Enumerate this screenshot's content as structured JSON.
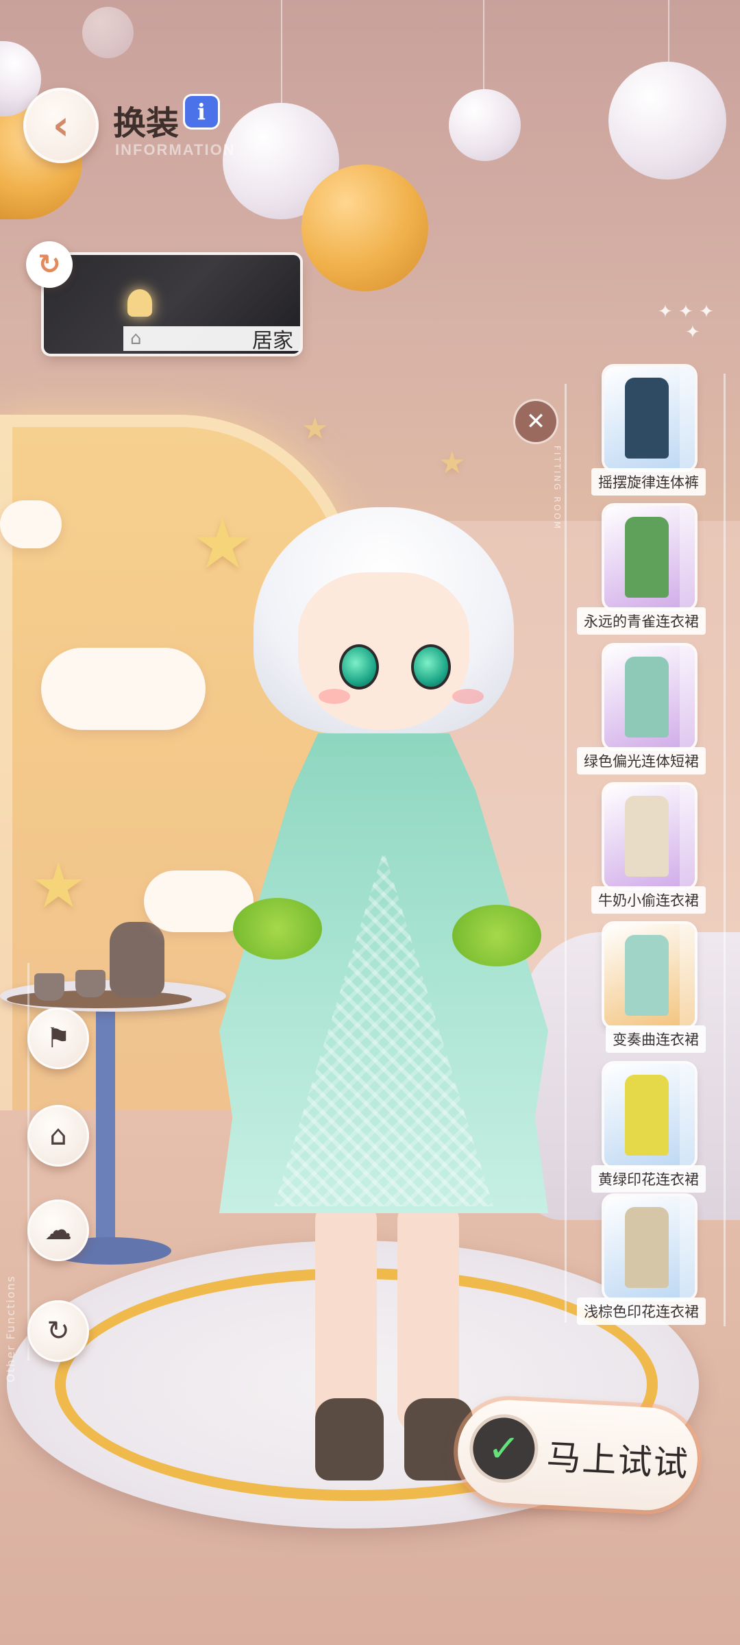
{
  "header": {
    "back_icon": "back-arrow-icon",
    "title": "换装",
    "info_label": "i",
    "subtitle": "INFORMATION"
  },
  "scene": {
    "label": "居家",
    "home_icon": "⌂",
    "refresh_icon": "↻"
  },
  "fitting_room": {
    "close_icon": "✕",
    "side_label": "FITTING ROOM",
    "outfits": [
      {
        "name": "摇摆旋律连体裤",
        "color": "#bcd7f3",
        "garment_color": "#2f4a63"
      },
      {
        "name": "永远的青雀连衣裙",
        "color": "#cfa9e8",
        "garment_color": "#5fa05a"
      },
      {
        "name": "绿色偏光连体短裙",
        "color": "#cfa9e8",
        "garment_color": "#8ec9b8"
      },
      {
        "name": "牛奶小偷连衣裙",
        "color": "#cfa9e8",
        "garment_color": "#e8dcc6"
      },
      {
        "name": "变奏曲连衣裙",
        "color": "#f2c27a",
        "garment_color": "#9fd4c6"
      },
      {
        "name": "黄绿印花连衣裙",
        "color": "#bcd7f3",
        "garment_color": "#e5d94a"
      },
      {
        "name": "浅棕色印花连衣裙",
        "color": "#bcd7f3",
        "garment_color": "#d6c6a8"
      }
    ]
  },
  "tools": [
    {
      "name": "wardrobe-icon",
      "glyph": "⚑"
    },
    {
      "name": "house-icon",
      "glyph": "⌂"
    },
    {
      "name": "weather-icon",
      "glyph": "☁"
    },
    {
      "name": "reset-icon",
      "glyph": "↻"
    }
  ],
  "other_functions_label": "Other Functions",
  "try_button": {
    "label": "马上试试",
    "check_icon": "✓"
  }
}
